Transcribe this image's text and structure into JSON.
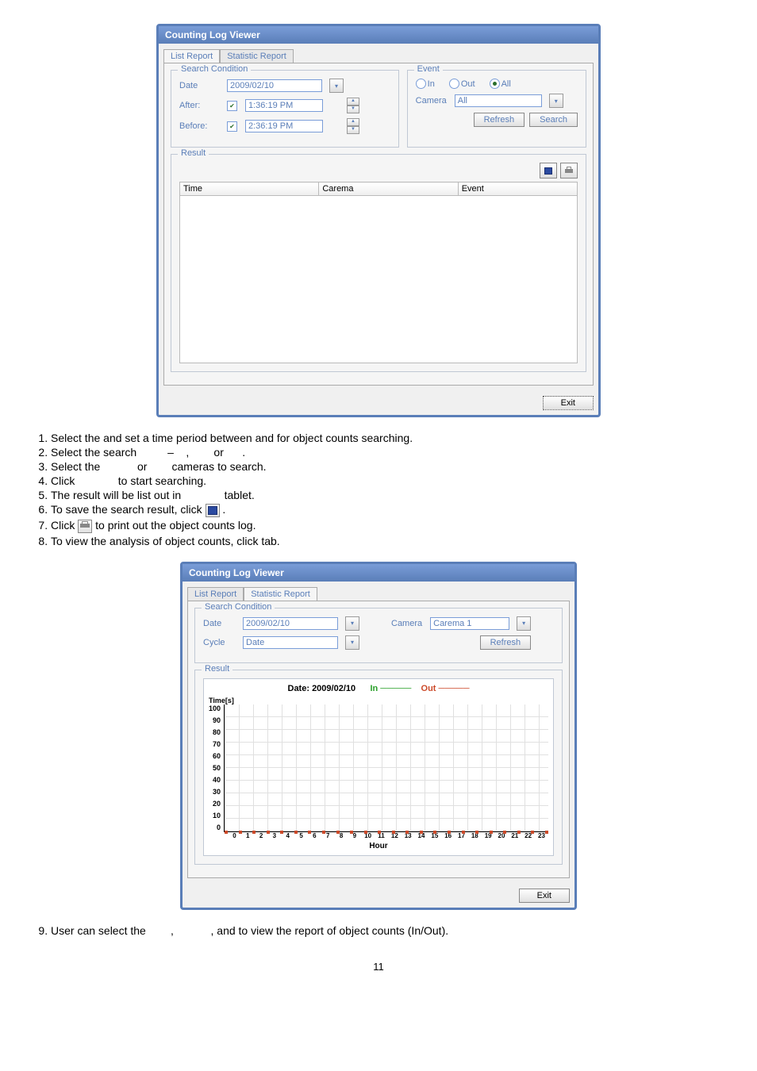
{
  "dialog1": {
    "title": "Counting Log Viewer",
    "tabs": {
      "list": "List Report",
      "stat": "Statistic Report"
    },
    "search": {
      "legend": "Search Condition",
      "date_label": "Date",
      "date_value": "2009/02/10",
      "after_label": "After:",
      "after_value": "1:36:19 PM",
      "before_label": "Before:",
      "before_value": "2:36:19 PM"
    },
    "event": {
      "legend": "Event",
      "in": "In",
      "out": "Out",
      "all": "All",
      "camera_label": "Camera",
      "camera_value": "All",
      "refresh": "Refresh",
      "search": "Search"
    },
    "result": {
      "legend": "Result",
      "cols": {
        "time": "Time",
        "camera": "Carema",
        "event": "Event"
      }
    },
    "exit": "Exit"
  },
  "instructions": {
    "i1a": "Select the ",
    "i1b": " and set a time period between ",
    "i1c": " and ",
    "i1d": " for object counts searching.",
    "i2": "Select the search          –    ,        or      .",
    "i3": "Select the            or        cameras to search.",
    "i4": "Click              to start searching.",
    "i5": "The result will be list out in              tablet.",
    "i6a": "To save the search result, click",
    "i6b": ".",
    "i7a": "Click ",
    "i7b": " to print out the object counts log.",
    "i8a": "To view the analysis of object counts, click ",
    "i8b": " tab."
  },
  "dialog2": {
    "title": "Counting Log Viewer",
    "tabs": {
      "list": "List Report",
      "stat": "Statistic Report"
    },
    "search": {
      "legend": "Search Condition",
      "date_label": "Date",
      "date_value": "2009/02/10",
      "cycle_label": "Cycle",
      "cycle_value": "Date",
      "camera_label": "Camera",
      "camera_value": "Carema 1",
      "refresh": "Refresh"
    },
    "result": {
      "legend": "Result"
    },
    "chart": {
      "title_prefix": "Date: ",
      "title_date": "2009/02/10",
      "in": "In",
      "out": "Out",
      "ylabel": "Time[s]",
      "xlabel": "Hour"
    },
    "exit": "Exit"
  },
  "post": {
    "i9a": "User can select the        ,            , and ",
    "i9b": " to view the report of object counts (In/Out)."
  },
  "page_number": "11",
  "chart_data": {
    "type": "line",
    "title": "Date: 2009/02/10",
    "xlabel": "Hour",
    "ylabel": "Time[s]",
    "x": [
      0,
      1,
      2,
      3,
      4,
      5,
      6,
      7,
      8,
      9,
      10,
      11,
      12,
      13,
      14,
      15,
      16,
      17,
      18,
      19,
      20,
      21,
      22,
      23
    ],
    "ylim": [
      0,
      100
    ],
    "yticks": [
      0,
      10,
      20,
      30,
      40,
      50,
      60,
      70,
      80,
      90,
      100
    ],
    "series": [
      {
        "name": "In",
        "color": "#2aa02a",
        "values": [
          0,
          0,
          0,
          0,
          0,
          0,
          0,
          0,
          0,
          0,
          0,
          0,
          0,
          0,
          0,
          0,
          0,
          0,
          0,
          0,
          0,
          0,
          0,
          0
        ]
      },
      {
        "name": "Out",
        "color": "#cc4a2a",
        "values": [
          0,
          0,
          0,
          0,
          0,
          0,
          0,
          0,
          0,
          0,
          0,
          0,
          0,
          0,
          0,
          0,
          0,
          0,
          0,
          0,
          0,
          0,
          0,
          0
        ]
      }
    ]
  }
}
